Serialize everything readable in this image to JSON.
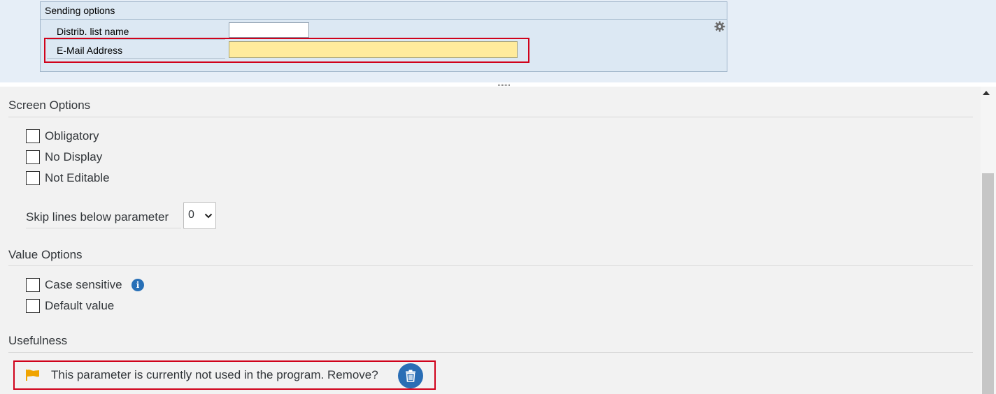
{
  "preview": {
    "group_title": "Sending options",
    "rows": [
      {
        "label": "Distrib. list name",
        "value": ""
      },
      {
        "label": "E-Mail Address",
        "value": ""
      }
    ]
  },
  "screen_options": {
    "title": "Screen Options",
    "checkboxes": [
      {
        "label": "Obligatory",
        "checked": false
      },
      {
        "label": "No Display",
        "checked": false
      },
      {
        "label": "Not Editable",
        "checked": false
      }
    ],
    "skip_lines_label": "Skip lines below parameter",
    "skip_lines_value": "0"
  },
  "value_options": {
    "title": "Value Options",
    "checkboxes": [
      {
        "label": "Case sensitive",
        "checked": false
      },
      {
        "label": "Default value",
        "checked": false
      }
    ],
    "info_glyph": "i"
  },
  "usefulness": {
    "title": "Usefulness",
    "message": "This parameter is currently not used in the program. Remove?"
  },
  "icons": {
    "settings": "gear-icon",
    "info": "info-icon",
    "flag": "flag-icon",
    "delete": "trash-icon"
  },
  "colors": {
    "highlight": "#d0021b",
    "required_field": "#ffeb9c",
    "accent": "#2a6eb5",
    "flag": "#f0a400"
  }
}
